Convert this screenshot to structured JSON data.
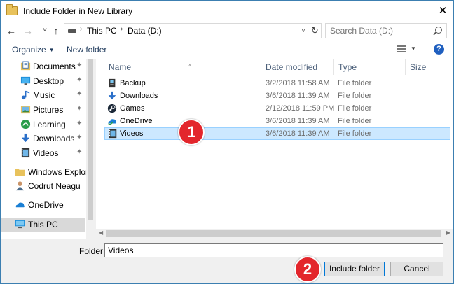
{
  "window": {
    "title": "Include Folder in New Library",
    "close_glyph": "✕"
  },
  "nav": {
    "back": "←",
    "forward": "→",
    "recent": "˅",
    "up": "↑",
    "breadcrumb": [
      "This PC",
      "Data (D:)"
    ],
    "separator": "›",
    "dropdown": "˅",
    "refresh": "↻"
  },
  "search": {
    "placeholder": "Search Data (D:)"
  },
  "toolbar": {
    "organize": "Organize",
    "new_folder": "New folder",
    "help": "?"
  },
  "sidebar": {
    "quick": [
      {
        "label": "Documents",
        "icon": "documents-icon"
      },
      {
        "label": "Desktop",
        "icon": "desktop-icon"
      },
      {
        "label": "Music",
        "icon": "music-icon"
      },
      {
        "label": "Pictures",
        "icon": "pictures-icon"
      },
      {
        "label": "Learning",
        "icon": "folder-icon"
      },
      {
        "label": "Downloads",
        "icon": "downloads-icon"
      },
      {
        "label": "Videos",
        "icon": "videos-icon"
      }
    ],
    "other": [
      {
        "label": "Windows Explorer",
        "icon": "folder-icon"
      },
      {
        "label": "Codrut Neagu",
        "icon": "user-icon"
      },
      {
        "label": "OneDrive",
        "icon": "onedrive-icon"
      },
      {
        "label": "This PC",
        "icon": "pc-icon"
      }
    ],
    "pin_glyph": "📌"
  },
  "columns": {
    "name": "Name",
    "date": "Date modified",
    "type": "Type",
    "size": "Size",
    "sort_glyph": "^"
  },
  "files": [
    {
      "name": "Backup",
      "date": "3/2/2018 11:58 AM",
      "type": "File folder",
      "icon": "backup-folder-icon"
    },
    {
      "name": "Downloads",
      "date": "3/6/2018 11:39 AM",
      "type": "File folder",
      "icon": "downloads-folder-icon"
    },
    {
      "name": "Games",
      "date": "2/12/2018 11:59 PM",
      "type": "File folder",
      "icon": "steam-folder-icon"
    },
    {
      "name": "OneDrive",
      "date": "3/6/2018 11:39 AM",
      "type": "File folder",
      "icon": "onedrive-folder-icon"
    },
    {
      "name": "Videos",
      "date": "3/6/2018 11:39 AM",
      "type": "File folder",
      "icon": "videos-folder-icon"
    }
  ],
  "footer": {
    "folder_label": "Folder:",
    "folder_value": "Videos",
    "include_button": "Include folder",
    "cancel_button": "Cancel"
  },
  "annotations": {
    "step1": "1",
    "step2": "2"
  },
  "colors": {
    "selection": "#cce8ff",
    "badge": "#e3262c",
    "accent": "#0078d7"
  }
}
